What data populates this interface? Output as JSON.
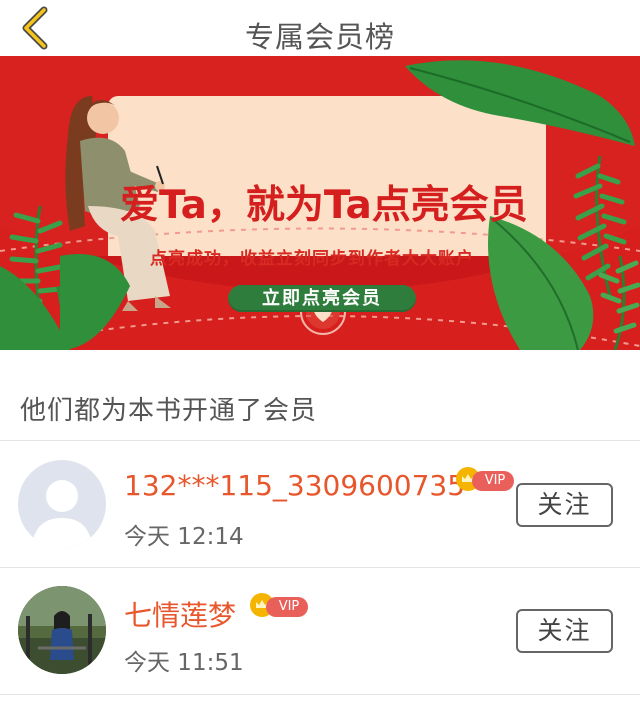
{
  "header": {
    "back_icon": "chevron-left-icon",
    "title": "专属会员榜"
  },
  "banner": {
    "title": "爱Ta，就为Ta点亮会员",
    "subtitle": "点亮成功，收益立刻同步到作者大大账户",
    "cta_label": "立即点亮会员",
    "colors": {
      "background": "#d7221f",
      "card": "#fde0c8",
      "cta": "#2f7d3c",
      "title": "#d51f1f"
    }
  },
  "section": {
    "title": "他们都为本书开通了会员"
  },
  "members": [
    {
      "name": "132***115_3309600735",
      "vip_label": "VIP",
      "time": "今天 12:14",
      "follow_label": "关注",
      "avatar": "default-avatar-icon"
    },
    {
      "name": "七情莲梦",
      "vip_label": "VIP",
      "time": "今天 11:51",
      "follow_label": "关注",
      "avatar": "photo-avatar"
    }
  ],
  "colors": {
    "accent_name": "#e8562c",
    "vip_badge": "#e9605b",
    "crown": "#f4b400"
  }
}
